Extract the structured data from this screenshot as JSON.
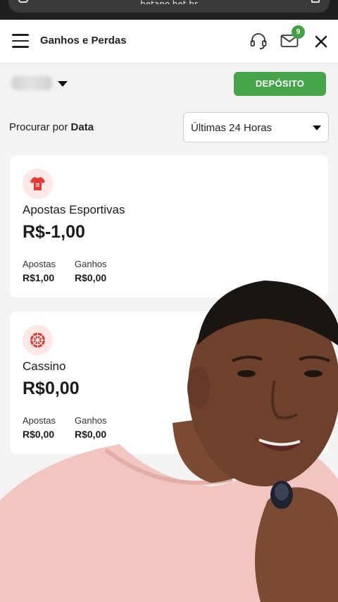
{
  "browser": {
    "url": "betano.bet.br"
  },
  "header": {
    "title": "Ganhos e Perdas",
    "mail_badge_count": "9"
  },
  "account": {
    "deposit_label": "DEPÓSITO"
  },
  "search": {
    "label_prefix": "Procurar por",
    "label_field": "Data",
    "period_value": "Últimas 24 Horas"
  },
  "cards": [
    {
      "title": "Apostas Esportivas",
      "amount": "R$-1,00",
      "stats": [
        {
          "label": "Apostas",
          "value": "R$1,00"
        },
        {
          "label": "Ganhos",
          "value": "R$0,00"
        }
      ]
    },
    {
      "title": "Cassino",
      "amount": "R$0,00",
      "stats": [
        {
          "label": "Apostas",
          "value": "R$0,00"
        },
        {
          "label": "Ganhos",
          "value": "R$0,00"
        }
      ]
    }
  ],
  "colors": {
    "accent_green": "#46a54b",
    "icon_red": "#e53935",
    "icon_bg": "#fde8e6"
  }
}
